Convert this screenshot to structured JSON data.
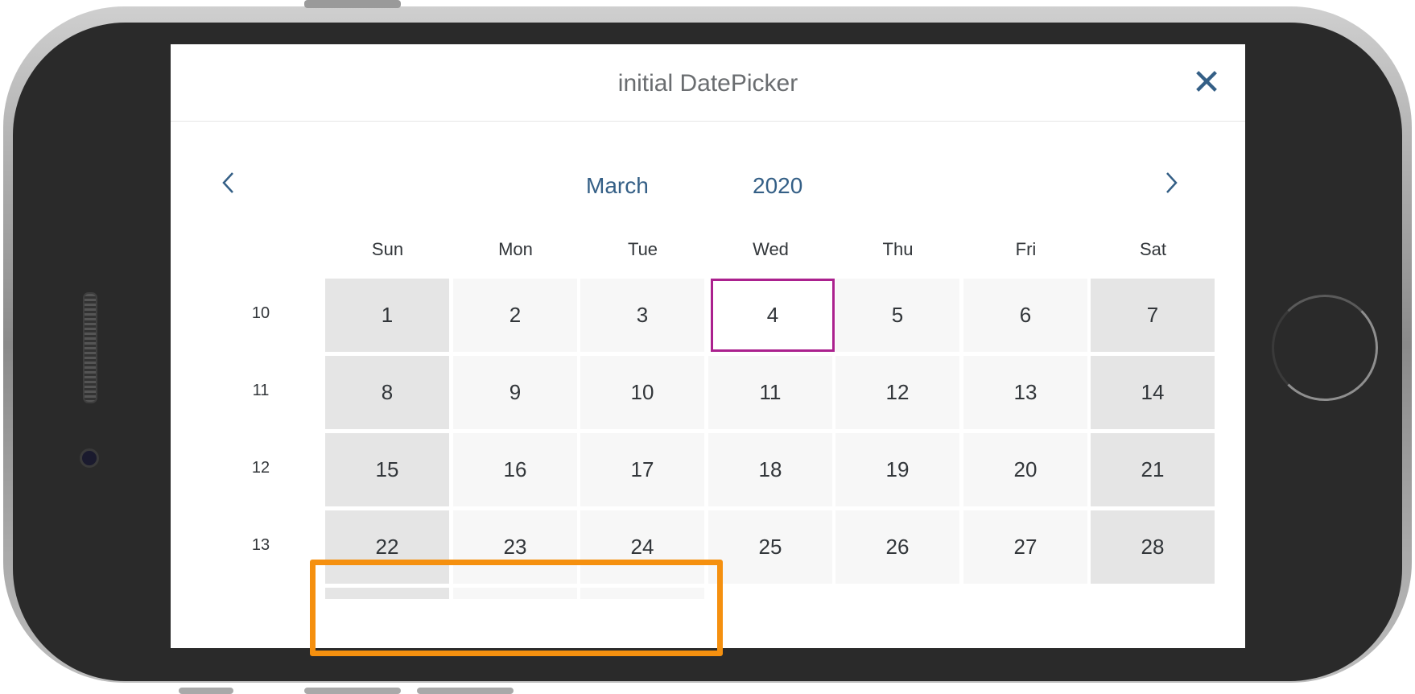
{
  "dialog": {
    "title": "initial DatePicker",
    "close_icon": "close-icon"
  },
  "calendar": {
    "month": "March",
    "year": "2020",
    "prev_icon": "chevron-left-icon",
    "next_icon": "chevron-right-icon",
    "weekdays": [
      "Sun",
      "Mon",
      "Tue",
      "Wed",
      "Thu",
      "Fri",
      "Sat"
    ],
    "week_numbers": [
      "10",
      "11",
      "12",
      "13"
    ],
    "weeks": [
      [
        "1",
        "2",
        "3",
        "4",
        "5",
        "6",
        "7"
      ],
      [
        "8",
        "9",
        "10",
        "11",
        "12",
        "13",
        "14"
      ],
      [
        "15",
        "16",
        "17",
        "18",
        "19",
        "20",
        "21"
      ],
      [
        "22",
        "23",
        "24",
        "25",
        "26",
        "27",
        "28"
      ]
    ],
    "today": "4"
  },
  "colors": {
    "accent": "#345f86",
    "today_border": "#ab218e",
    "highlight": "#f5900f",
    "weekend_bg": "#e5e5e5",
    "weekday_bg": "#f7f7f7"
  }
}
